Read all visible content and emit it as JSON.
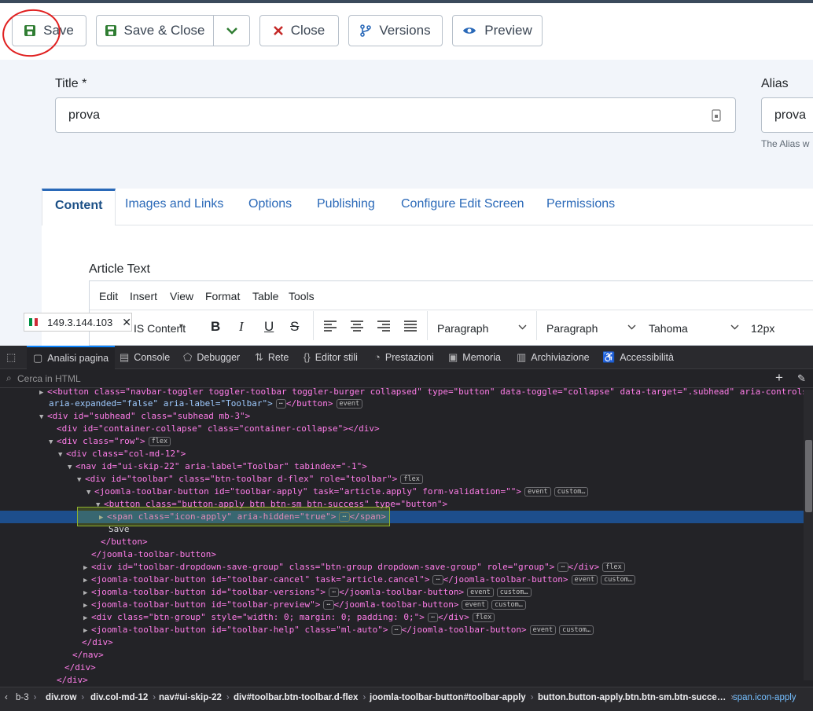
{
  "toolbar": {
    "save_label": "Save",
    "save_close_label": "Save & Close",
    "close_label": "Close",
    "versions_label": "Versions",
    "preview_label": "Preview"
  },
  "form": {
    "title_label": "Title *",
    "title_value": "prova",
    "alias_label": "Alias",
    "alias_value": "prova",
    "alias_hint": "The Alias w"
  },
  "tabs": [
    "Content",
    "Images and Links",
    "Options",
    "Publishing",
    "Configure Edit Screen",
    "Permissions"
  ],
  "editor": {
    "label": "Article Text",
    "menus": [
      "Edit",
      "Insert",
      "View",
      "Format",
      "Table",
      "Tools"
    ],
    "cms_content": "IS Content",
    "format1": "Paragraph",
    "format2": "Paragraph",
    "font": "Tahoma",
    "size": "12px"
  },
  "ip_overlay": {
    "ip": "149.3.144.103"
  },
  "devtools": {
    "tabs": [
      "Analisi pagina",
      "Console",
      "Debugger",
      "Rete",
      "Editor stili",
      "Prestazioni",
      "Memoria",
      "Archiviazione",
      "Accessibilità"
    ],
    "search_placeholder": "Cerca in HTML",
    "lines": [
      "<button class=\"navbar-toggler toggler-toolbar toggler-burger collapsed\" type=\"button\" data-toggle=\"collapse\" data-target=\".subhead\" aria-controls=\"subhead\"",
      "aria-expanded=\"false\" aria-label=\"Toolbar\">",
      "</button>",
      "<div id=\"subhead\" class=\"subhead mb-3\">",
      "<div id=\"container-collapse\" class=\"container-collapse\"></div>",
      "<div class=\"row\">",
      "<div class=\"col-md-12\">",
      "<nav id=\"ui-skip-22\" aria-label=\"Toolbar\" tabindex=\"-1\">",
      "<div id=\"toolbar\" class=\"btn-toolbar d-flex\" role=\"toolbar\">",
      "<joomla-toolbar-button id=\"toolbar-apply\" task=\"article.apply\" form-validation=\"\">",
      "<button class=\"button-apply btn btn-sm btn-success\" type=\"button\">",
      "<span class=\"icon-apply\" aria-hidden=\"true\">",
      "</span>",
      "Save",
      "</button>",
      "</joomla-toolbar-button>",
      "<div id=\"toolbar-dropdown-save-group\" class=\"btn-group dropdown-save-group\" role=\"group\">",
      "</div>",
      "<joomla-toolbar-button id=\"toolbar-cancel\" task=\"article.cancel\">",
      "</joomla-toolbar-button>",
      "<joomla-toolbar-button id=\"toolbar-versions\">",
      "</joomla-toolbar-button>",
      "<joomla-toolbar-button id=\"toolbar-preview\">",
      "</joomla-toolbar-button>",
      "<div class=\"btn-group\" style=\"width: 0; margin: 0; padding: 0;\">",
      "</div>",
      "<joomla-toolbar-button id=\"toolbar-help\" class=\"ml-auto\">",
      "</joomla-toolbar-button>",
      "</div>",
      "</nav>",
      "</div>",
      "</div>"
    ],
    "badges": {
      "event": "event",
      "flex": "flex",
      "custom": "custom…",
      "ellipsis": "⋯"
    },
    "breadcrumbs": [
      "b-3",
      "div.row",
      "div.col-md-12",
      "nav#ui-skip-22",
      "div#toolbar.btn-toolbar.d-flex",
      "joomla-toolbar-button#toolbar-apply",
      "button.button-apply.btn.btn-sm.btn-succe…",
      "span.icon-apply"
    ]
  }
}
